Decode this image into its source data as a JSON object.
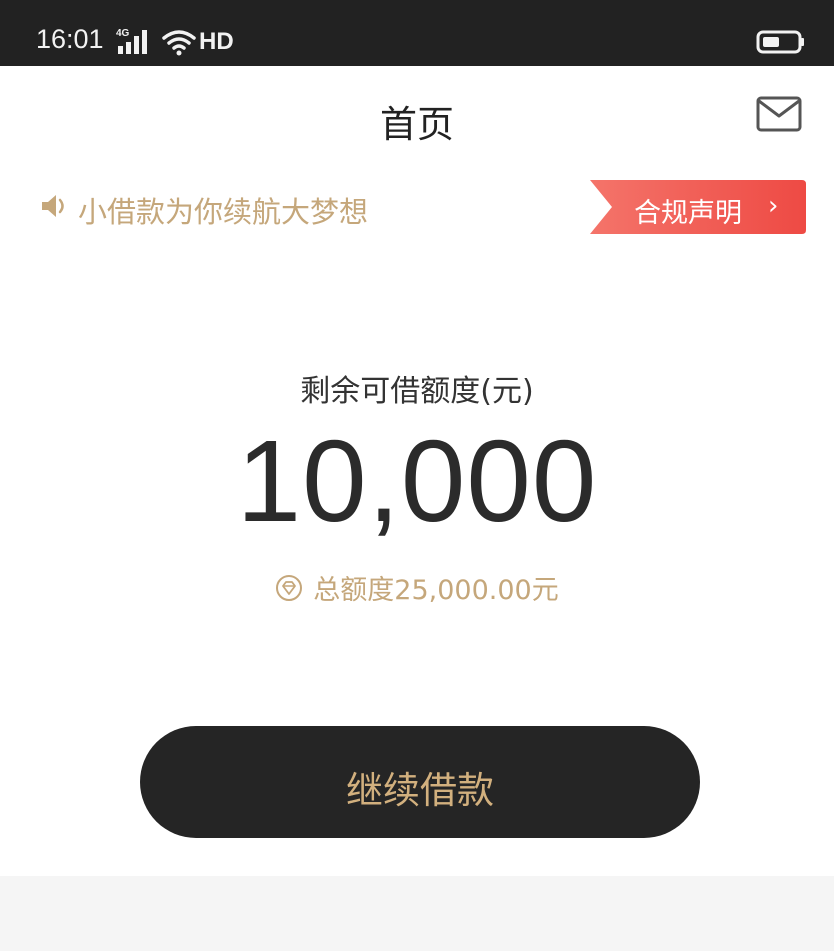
{
  "status_bar": {
    "time": "16:01",
    "network": "4G",
    "hd": "HD",
    "icons": [
      "signal-icon",
      "wifi-icon",
      "battery-icon"
    ]
  },
  "header": {
    "title": "首页",
    "mail_icon": "mail-icon"
  },
  "notice": {
    "text": "小借款为你续航大梦想",
    "icon": "speaker-icon",
    "compliance_label": "合规声明",
    "compliance_arrow": "›"
  },
  "credit": {
    "label": "剩余可借额度(元)",
    "amount": "10,000",
    "total": "总额度25,000.00元",
    "total_icon": "diamond-icon"
  },
  "action": {
    "borrow_label": "继续借款"
  },
  "colors": {
    "status_bar_bg": "#222222",
    "gold_text": "#c5a77b",
    "button_bg": "#252525",
    "button_text": "#d2b07e",
    "compliance_bg": "#f0544a"
  }
}
